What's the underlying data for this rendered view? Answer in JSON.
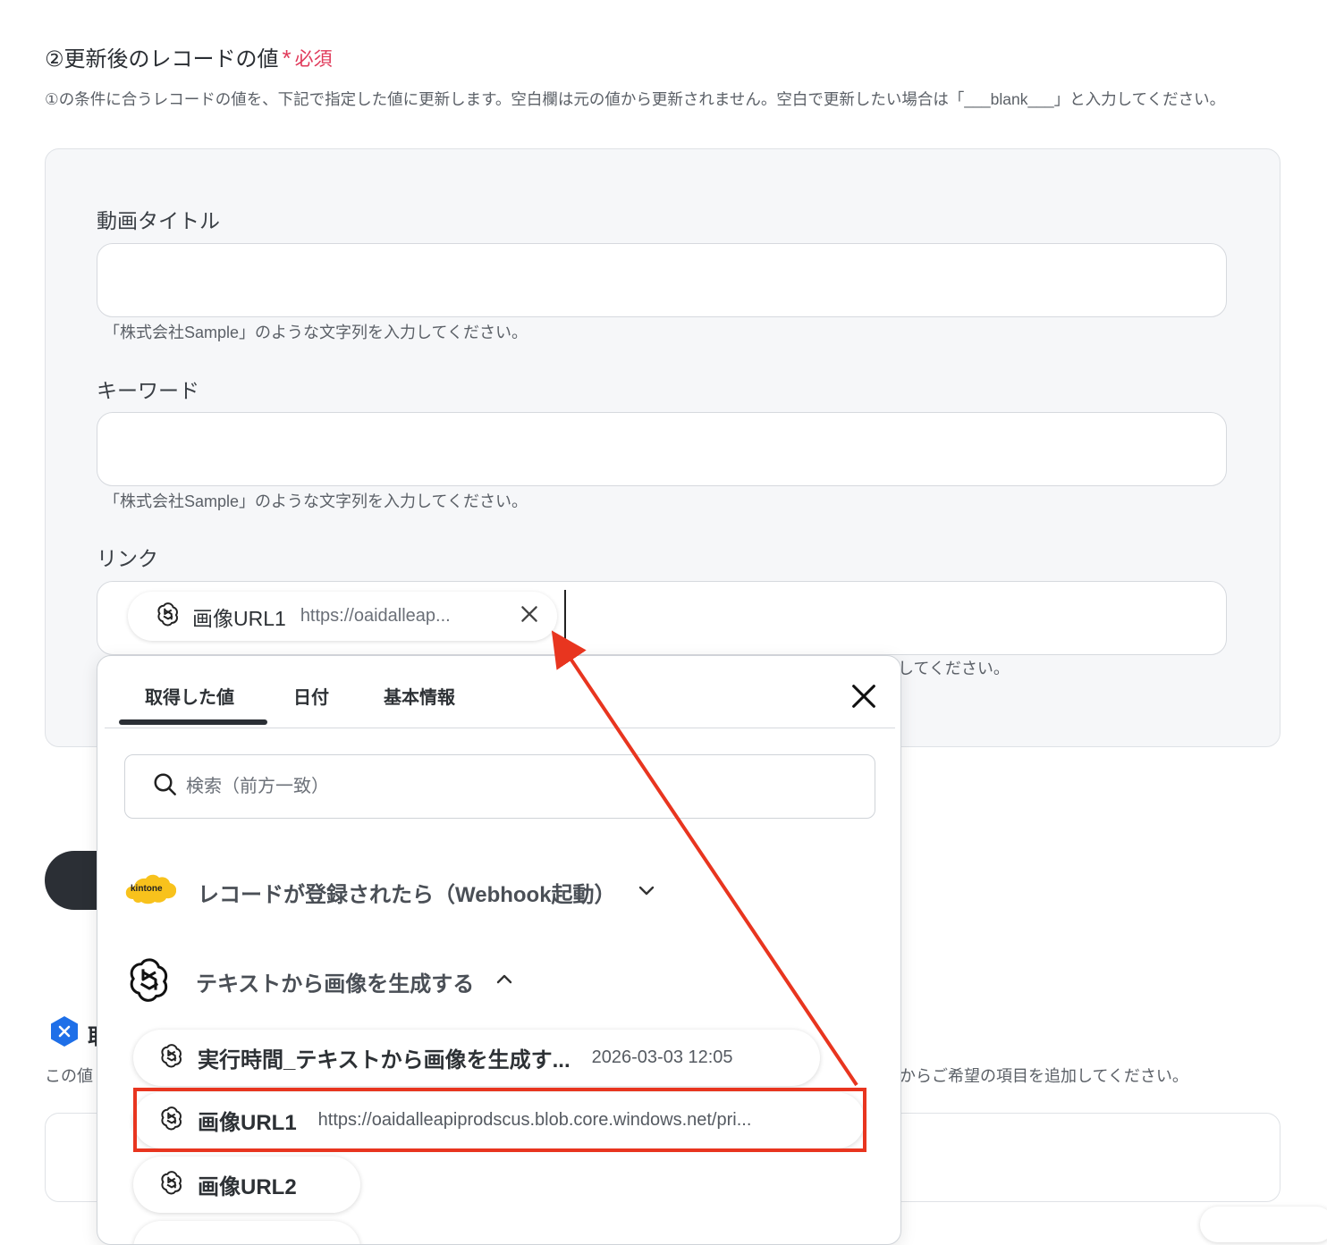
{
  "section": {
    "title": "②更新後のレコードの値",
    "required": "必須",
    "description": "①の条件に合うレコードの値を、下記で指定した値に更新します。空白欄は元の値から更新されません。空白で更新したい場合は「___blank___」と入力してください。"
  },
  "fields": [
    {
      "label": "動画タイトル",
      "hint": "「株式会社Sample」のような文字列を入力してください。"
    },
    {
      "label": "キーワード",
      "hint": "「株式会社Sample」のような文字列を入力してください。"
    },
    {
      "label": "リンク",
      "hint_visible_tail": "してください。"
    }
  ],
  "link_chip": {
    "name": "画像URL1",
    "url": "https://oaidalleap..."
  },
  "background": {
    "bottom_description_tail": "からご希望の項目を追加してください。",
    "bottom_description_head": "この値",
    "partial_heading_char": "取"
  },
  "popup": {
    "tabs": [
      "取得した値",
      "日付",
      "基本情報"
    ],
    "active_tab": 0,
    "search_placeholder": "検索（前方一致）",
    "groups": [
      {
        "label": "レコードが登録されたら（Webhook起動）",
        "icon": "kintone-logo",
        "expanded": false,
        "logo_text": "kintone"
      },
      {
        "label": "テキストから画像を生成する",
        "icon": "openai-icon",
        "expanded": true
      }
    ],
    "items": [
      {
        "name": "実行時間_テキストから画像を生成す...",
        "value": "2026-03-03 12:05"
      },
      {
        "name": "画像URL1",
        "value": "https://oaidalleapiprodscus.blob.core.windows.net/pri..."
      },
      {
        "name": "画像URL2",
        "value": ""
      }
    ]
  },
  "colors": {
    "required": "#e03a5a",
    "highlight": "#e8351f",
    "dark_button": "#2b2f35",
    "badge_blue": "#1e6fe8",
    "kintone_yellow": "#f8c21c"
  }
}
